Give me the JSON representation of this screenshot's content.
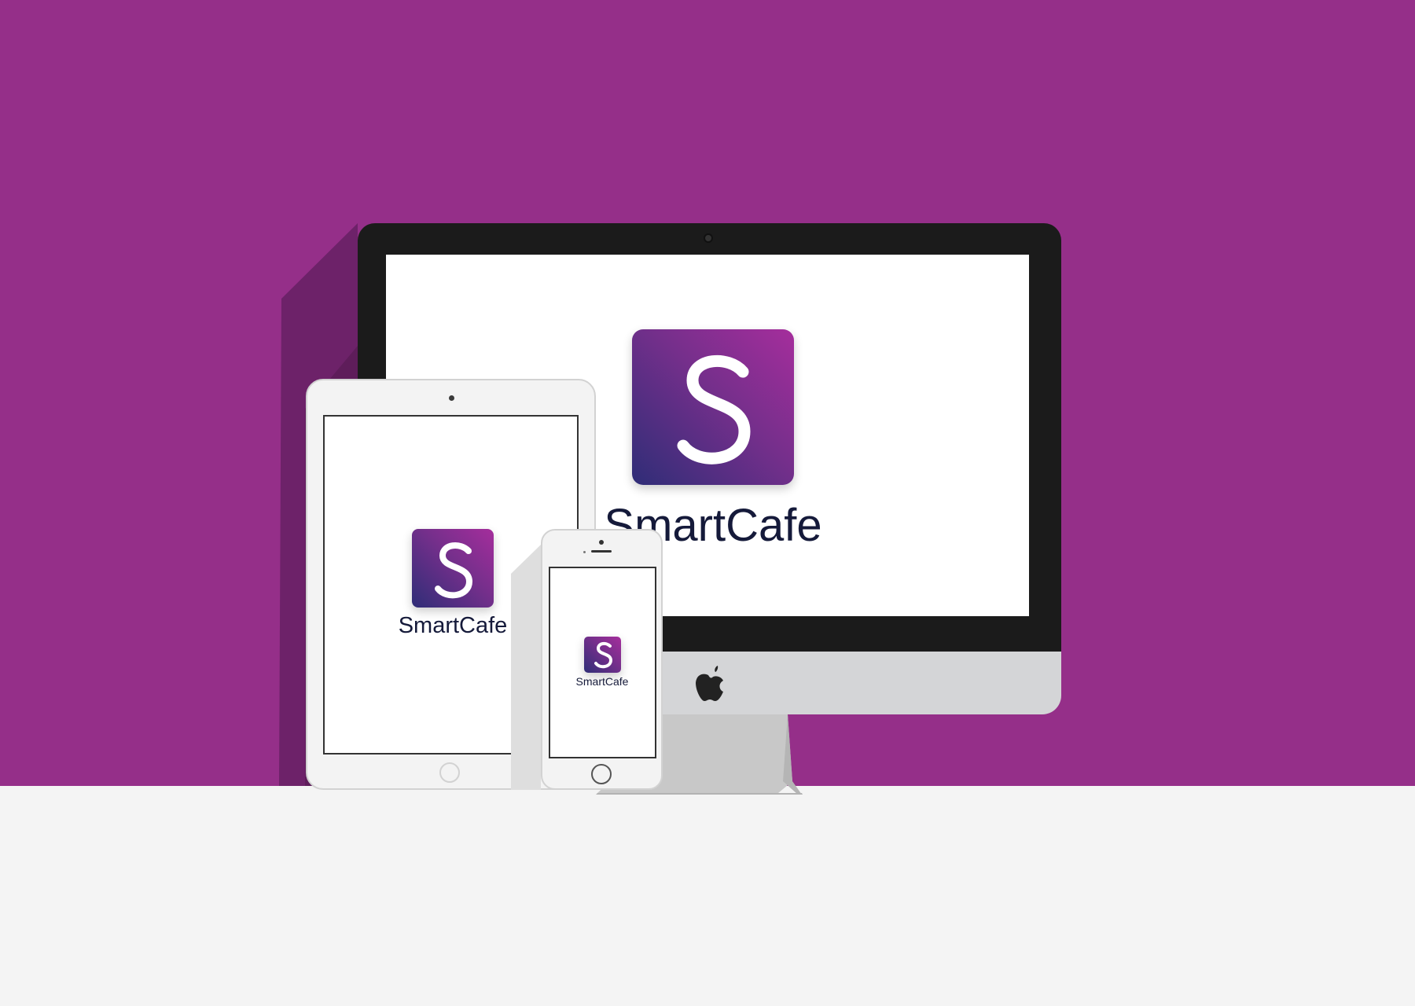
{
  "scene": {
    "background_color": "#952f89",
    "floor_color": "#f4f4f4",
    "brand_name": "SmartCafe",
    "logo_letter": "S",
    "logo_gradient": [
      "#a52e9c",
      "#742f8b",
      "#2f2d77"
    ]
  },
  "devices": {
    "imac": {
      "brand_name": "SmartCafe",
      "logo_letter": "S",
      "apple_icon": "apple-logo-icon"
    },
    "ipad": {
      "brand_name": "SmartCafe",
      "logo_letter": "S"
    },
    "iphone": {
      "brand_name": "SmartCafe",
      "logo_letter": "S"
    }
  }
}
